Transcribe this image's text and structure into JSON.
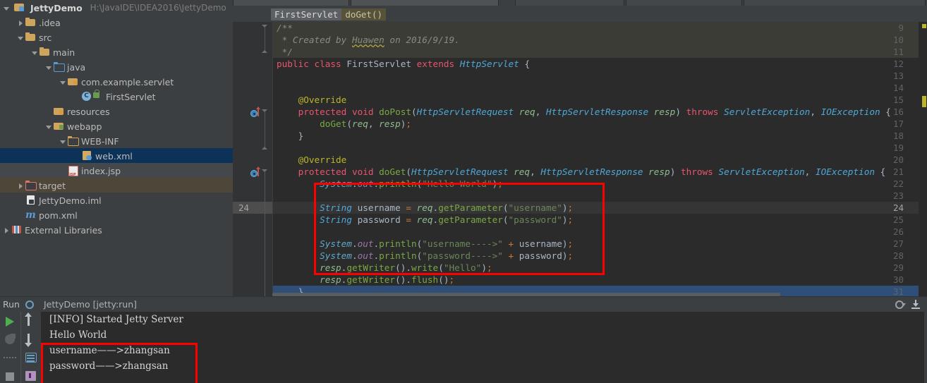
{
  "project": {
    "name": "JettyDemo",
    "path": "H:\\JavaIDE\\IDEA2016\\JettyDemo",
    "tree": [
      {
        "label": ".idea",
        "indent": 1,
        "arrow": "closed",
        "icon": "folder"
      },
      {
        "label": "src",
        "indent": 1,
        "arrow": "open",
        "icon": "folder"
      },
      {
        "label": "main",
        "indent": 2,
        "arrow": "open",
        "icon": "folder"
      },
      {
        "label": "java",
        "indent": 3,
        "arrow": "open",
        "icon": "folder-blue-hollow"
      },
      {
        "label": "com.example.servlet",
        "indent": 4,
        "arrow": "open",
        "icon": "package-folder"
      },
      {
        "label": "FirstServlet",
        "indent": 5,
        "arrow": "none",
        "icon": "java-class"
      },
      {
        "label": "resources",
        "indent": 3,
        "arrow": "none",
        "icon": "resources-folder"
      },
      {
        "label": "webapp",
        "indent": 3,
        "arrow": "open",
        "icon": "webapp-folder"
      },
      {
        "label": "WEB-INF",
        "indent": 4,
        "arrow": "open",
        "icon": "folder-hollow"
      },
      {
        "label": "web.xml",
        "indent": 5,
        "arrow": "none",
        "icon": "xml-file",
        "state": "selected"
      },
      {
        "label": "index.jsp",
        "indent": 4,
        "arrow": "none",
        "icon": "jsp-file",
        "state": "mild"
      },
      {
        "label": "target",
        "indent": 1,
        "arrow": "closed",
        "icon": "folder-red-hollow",
        "state": "target"
      },
      {
        "label": "JettyDemo.iml",
        "indent": 1,
        "arrow": "none",
        "icon": "iml-file"
      },
      {
        "label": "pom.xml",
        "indent": 1,
        "arrow": "none",
        "icon": "maven-file"
      },
      {
        "label": "External Libraries",
        "indent": 0,
        "arrow": "closed",
        "icon": "libraries-icon"
      }
    ]
  },
  "editor": {
    "breadcrumb": {
      "class_name": "FirstServlet",
      "method_name": "doGet()"
    },
    "first_line_number": 9,
    "current_line": 24,
    "lines": [
      {
        "n": 9,
        "text": "/**"
      },
      {
        "n": 10,
        "text": " * Created by Huawen on 2016/9/19."
      },
      {
        "n": 11,
        "text": " */"
      },
      {
        "n": 12,
        "text": "public class FirstServlet extends HttpServlet {"
      },
      {
        "n": 13,
        "text": ""
      },
      {
        "n": 14,
        "text": ""
      },
      {
        "n": 15,
        "text": "    @Override"
      },
      {
        "n": 16,
        "text": "    protected void doPost(HttpServletRequest req, HttpServletResponse resp) throws ServletException, IOException {"
      },
      {
        "n": 17,
        "text": "        doGet(req, resp);"
      },
      {
        "n": 18,
        "text": "    }"
      },
      {
        "n": 19,
        "text": ""
      },
      {
        "n": 20,
        "text": "    @Override"
      },
      {
        "n": 21,
        "text": "    protected void doGet(HttpServletRequest req, HttpServletResponse resp) throws ServletException, IOException {"
      },
      {
        "n": 22,
        "text": "        System.out.println(\"Hello World\");"
      },
      {
        "n": 23,
        "text": ""
      },
      {
        "n": 24,
        "text": "        String username = req.getParameter(\"username\");"
      },
      {
        "n": 25,
        "text": "        String password = req.getParameter(\"password\");"
      },
      {
        "n": 26,
        "text": ""
      },
      {
        "n": 27,
        "text": "        System.out.println(\"username---->\" + username);"
      },
      {
        "n": 28,
        "text": "        System.out.println(\"password---->\" + password);"
      },
      {
        "n": 29,
        "text": "        resp.getWriter().write(\"Hello\");"
      },
      {
        "n": 30,
        "text": "        resp.getWriter().flush();"
      },
      {
        "n": 31,
        "text": "    }"
      }
    ],
    "override_marker_lines": [
      16,
      21
    ]
  },
  "run_panel": {
    "title": "Run",
    "configuration": "JettyDemo [jetty:run]",
    "console_lines": [
      "[INFO] Started Jetty Server",
      "Hello World",
      "username——>zhangsan",
      "password——>zhangsan"
    ]
  },
  "colors": {
    "annotation_red": "#ff0000",
    "panel_bg": "#3c3f41",
    "editor_bg": "#2b2b2b",
    "selection_blue": "#0d3258"
  }
}
